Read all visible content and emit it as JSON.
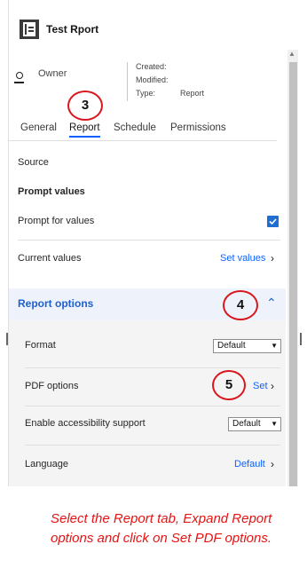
{
  "header": {
    "title": "Test Rport"
  },
  "owner": {
    "label": "Owner"
  },
  "meta": {
    "created_label": "Created:",
    "modified_label": "Modified:",
    "type_label": "Type:",
    "type_value": "Report"
  },
  "tabs": [
    {
      "label": "General",
      "active": false
    },
    {
      "label": "Report",
      "active": true
    },
    {
      "label": "Schedule",
      "active": false
    },
    {
      "label": "Permissions",
      "active": false
    }
  ],
  "report": {
    "source_label": "Source",
    "prompt_values_heading": "Prompt values",
    "prompt_for_values_label": "Prompt for values",
    "prompt_for_values_checked": true,
    "current_values_label": "Current values",
    "set_values_link": "Set values"
  },
  "report_options": {
    "heading": "Report options",
    "expanded": true,
    "format_label": "Format",
    "format_value": "Default",
    "pdf_options_label": "PDF options",
    "pdf_set_link": "Set",
    "accessibility_label": "Enable accessibility support",
    "accessibility_value": "Default",
    "language_label": "Language",
    "language_link": "Default"
  },
  "annotations": {
    "step3": "3",
    "step4": "4",
    "step5": "5",
    "caption": "Select the Report tab, Expand Report options and click on Set PDF options."
  },
  "colors": {
    "accent": "#0f62fe",
    "annotation": "#e51414",
    "checkbox": "#1f6fd1"
  }
}
